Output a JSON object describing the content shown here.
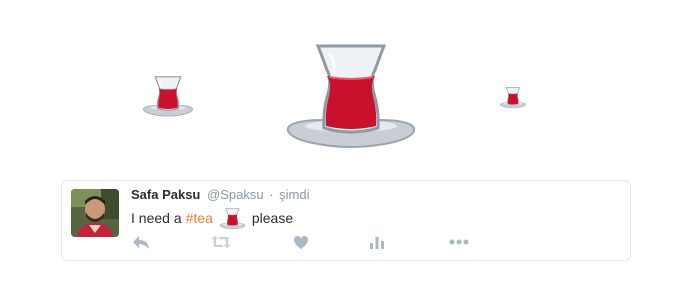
{
  "tweet": {
    "display_name": "Safa Paksu",
    "handle": "@Spaksu",
    "separator": "·",
    "time": "şimdi",
    "text_before": "I need a",
    "hashtag": "#tea",
    "text_after": "please"
  },
  "icons": {
    "hero": [
      "turkish-tea-glass",
      "turkish-tea-glass",
      "turkish-tea-glass"
    ],
    "inline_emoji": "turkish-tea-glass",
    "actions": [
      "reply-icon",
      "retweet-icon",
      "like-icon",
      "analytics-icon",
      "more-icon"
    ]
  },
  "colors": {
    "tea": "#c9102c",
    "saucer": "#c8ced3",
    "hashtag": "#f27b3b",
    "action_icons": "#aab8c2",
    "muted_text": "#8899a6"
  }
}
